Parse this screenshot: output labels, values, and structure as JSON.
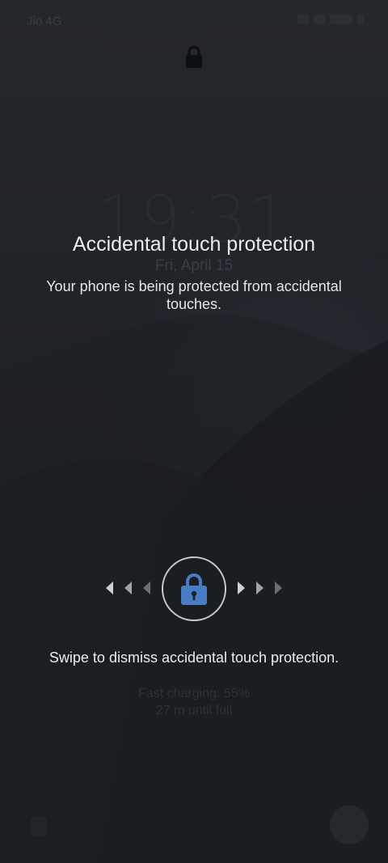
{
  "status_bar": {
    "carrier": "Jio 4G",
    "icons": [
      "alarm-icon",
      "wifi-icon",
      "signal-icon",
      "battery-icon"
    ]
  },
  "lockscreen": {
    "time": "19:31",
    "date": "Fri, April 15",
    "charging_status": "Fast charging: 55%",
    "charging_remaining": "27 m until full"
  },
  "overlay": {
    "title": "Accidental touch protection",
    "message": "Your phone is being protected from accidental touches.",
    "swipe_hint": "Swipe to dismiss accidental touch protection."
  },
  "colors": {
    "lock_icon": "#4a7cc4",
    "text": "#ececec"
  }
}
